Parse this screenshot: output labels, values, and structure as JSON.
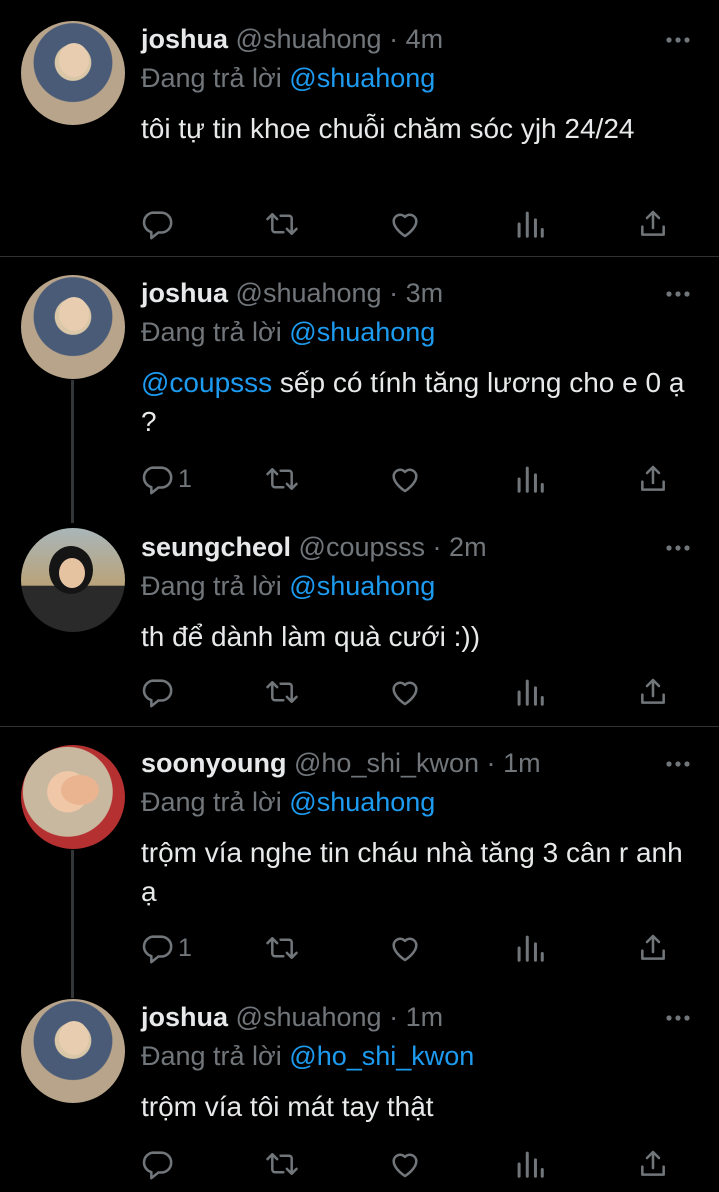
{
  "tweets": [
    {
      "name": "joshua",
      "handle": "@shuahong",
      "dot": "·",
      "time": "4m",
      "reply_prefix": "Đang trả lời",
      "reply_to": "@shuahong",
      "mention": "",
      "text": "tôi tự tin khoe chuỗi chăm sóc yjh 24/24",
      "replies": "",
      "avatar_icon": "avatar-joshua"
    },
    {
      "name": "joshua",
      "handle": "@shuahong",
      "dot": "·",
      "time": "3m",
      "reply_prefix": "Đang trả lời",
      "reply_to": "@shuahong",
      "mention": "@coupsss",
      "text": " sếp có tính tăng lương cho e 0 ạ ?",
      "replies": "1",
      "avatar_icon": "avatar-joshua"
    },
    {
      "name": "seungcheol",
      "handle": "@coupsss",
      "dot": "·",
      "time": "2m",
      "reply_prefix": "Đang trả lời",
      "reply_to": "@shuahong",
      "mention": "",
      "text": "th để dành làm quà cưới :))",
      "replies": "",
      "avatar_icon": "avatar-seungcheol"
    },
    {
      "name": "soonyoung",
      "handle": "@ho_shi_kwon",
      "dot": "·",
      "time": "1m",
      "reply_prefix": "Đang trả lời",
      "reply_to": "@shuahong",
      "mention": "",
      "text": "trộm vía nghe tin cháu nhà tăng 3 cân r anh ạ",
      "replies": "1",
      "avatar_icon": "avatar-soonyoung"
    },
    {
      "name": "joshua",
      "handle": "@shuahong",
      "dot": "·",
      "time": "1m",
      "reply_prefix": "Đang trả lời",
      "reply_to": "@ho_shi_kwon",
      "mention": "",
      "text": "trộm vía tôi mát tay thật",
      "replies": "",
      "avatar_icon": "avatar-joshua"
    }
  ],
  "colors": {
    "background": "#000000",
    "text": "#e7e9ea",
    "muted": "#71767b",
    "link": "#1d9bf0",
    "divider": "#2f3336"
  },
  "icons": [
    "more-icon",
    "reply-icon",
    "retweet-icon",
    "like-icon",
    "views-icon",
    "share-icon"
  ]
}
